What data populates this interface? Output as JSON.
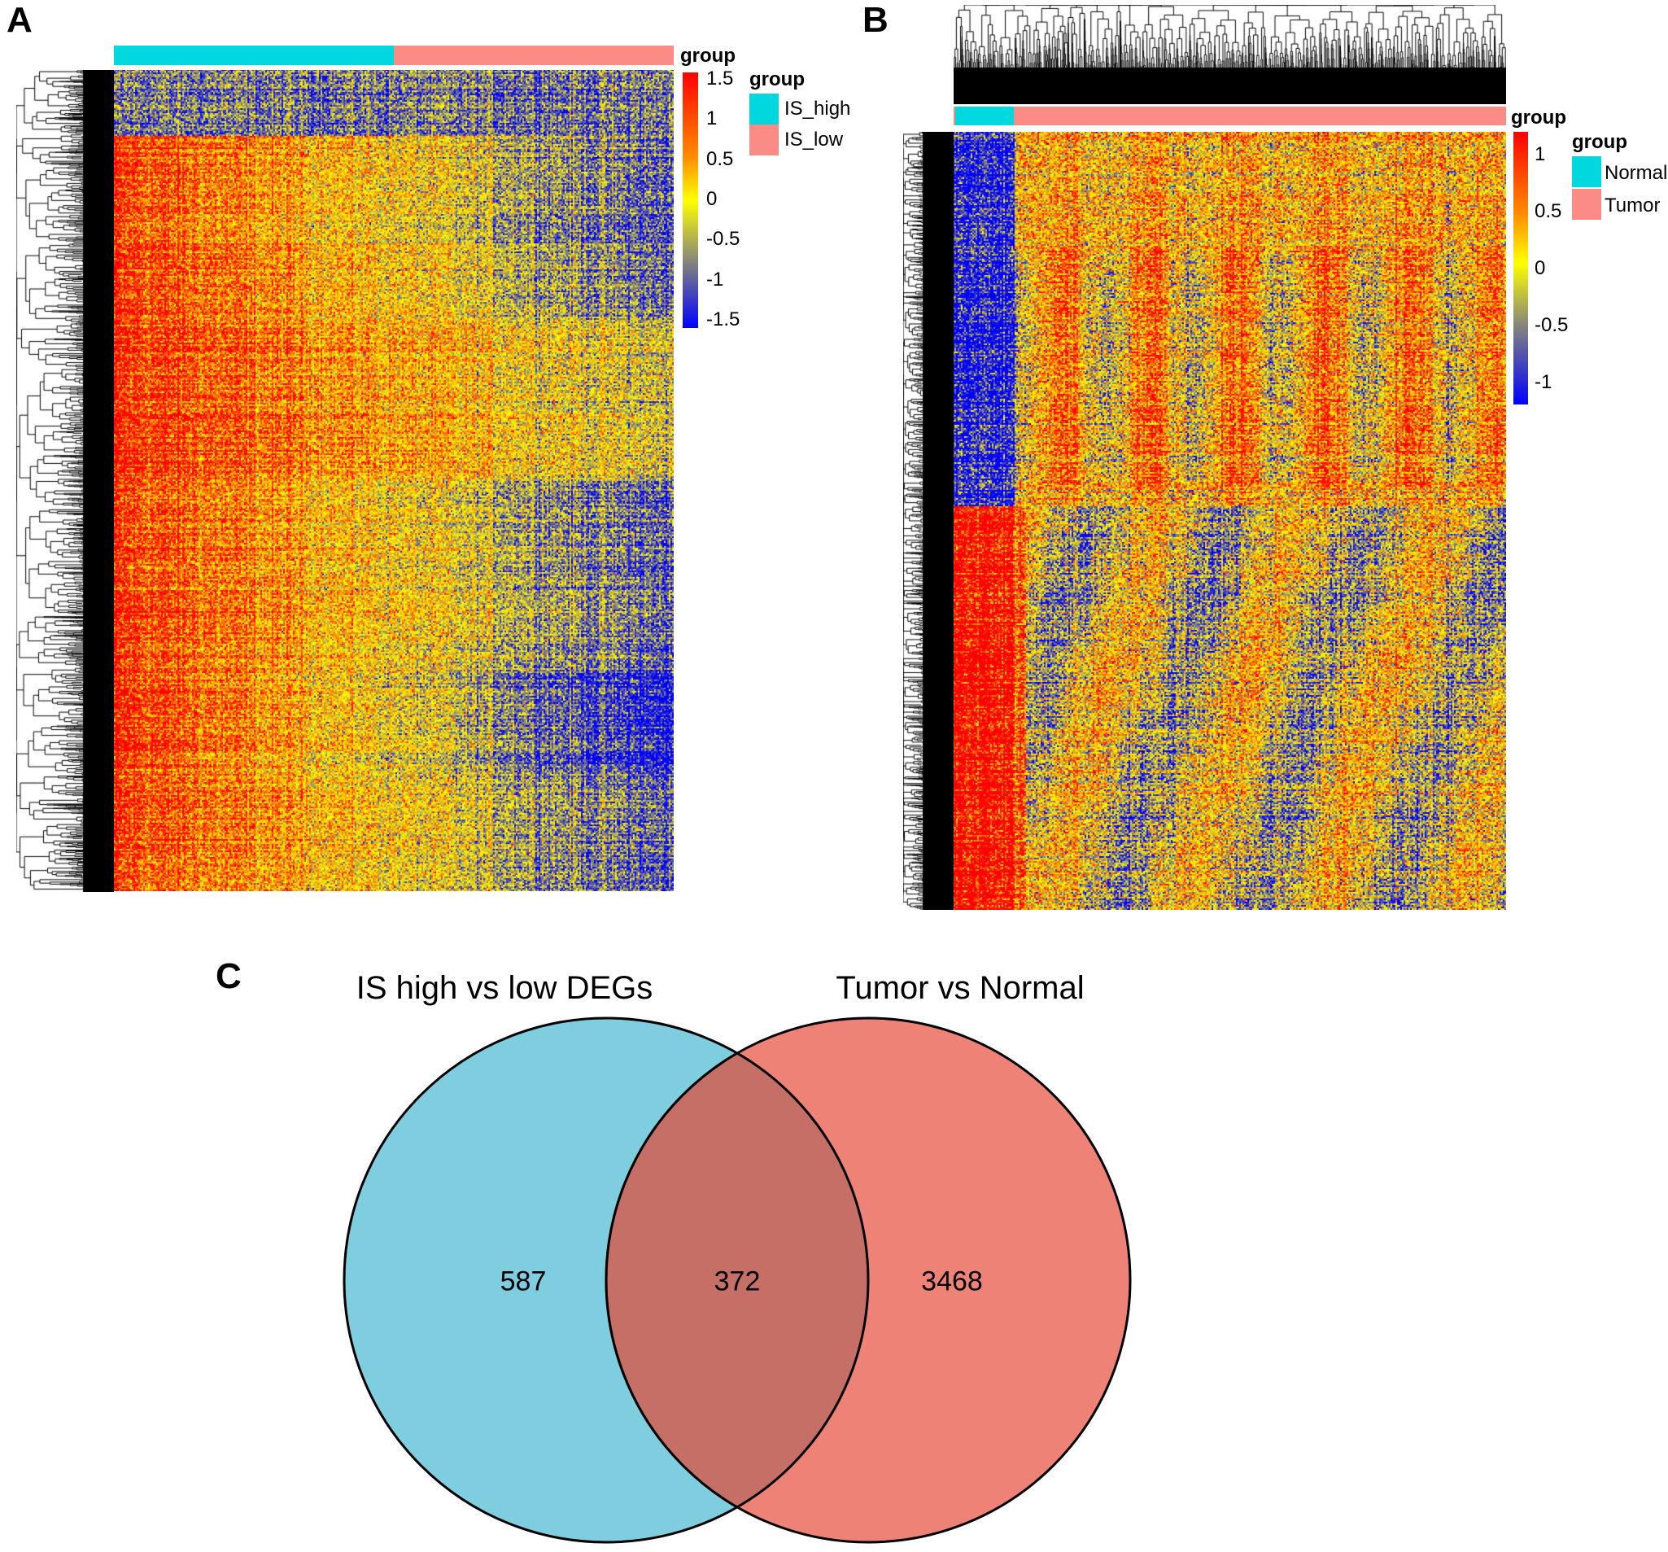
{
  "panels": {
    "A": {
      "label": "A",
      "annotation_title": "group",
      "legend_title": "group",
      "legend": [
        {
          "label": "IS_high",
          "color": "#00D7DE"
        },
        {
          "label": "IS_low",
          "color": "#FA8C85"
        }
      ],
      "colorbar_ticks": [
        "1.5",
        "1",
        "0.5",
        "0",
        "-0.5",
        "-1",
        "-1.5"
      ]
    },
    "B": {
      "label": "B",
      "annotation_title": "group",
      "legend_title": "group",
      "legend": [
        {
          "label": "Normal",
          "color": "#00D7DE"
        },
        {
          "label": "Tumor",
          "color": "#FA8C85"
        }
      ],
      "colorbar_ticks": [
        "1",
        "0.5",
        "0",
        "-0.5",
        "-1"
      ]
    },
    "C": {
      "label": "C"
    }
  },
  "chart_data": [
    {
      "type": "heatmap",
      "panel": "A",
      "column_groups": [
        {
          "name": "IS_high",
          "fraction": 0.5
        },
        {
          "name": "IS_low",
          "fraction": 0.5
        }
      ],
      "color_scale": {
        "min": -1.5,
        "max": 1.5,
        "colors": [
          "#0000FF",
          "#808080",
          "#FFFF00",
          "#FF8C00",
          "#FF0000"
        ]
      },
      "row_dendrogram": true,
      "column_dendrogram": false
    },
    {
      "type": "heatmap",
      "panel": "B",
      "column_groups": [
        {
          "name": "Normal",
          "fraction": 0.11
        },
        {
          "name": "Tumor",
          "fraction": 0.89
        }
      ],
      "color_scale": {
        "min": -1.2,
        "max": 1.2,
        "colors": [
          "#0000FF",
          "#808080",
          "#FFFF00",
          "#FF8C00",
          "#FF0000"
        ]
      },
      "row_dendrogram": true,
      "column_dendrogram": true
    },
    {
      "type": "venn",
      "panel": "C",
      "sets": [
        {
          "name": "IS high vs low DEGs",
          "only": "587",
          "color": "#7FCEE0"
        },
        {
          "name": "Tumor vs Normal",
          "only": "3468",
          "color": "#EF8276"
        }
      ],
      "intersection": "372",
      "intersection_color": "#C66F67"
    }
  ]
}
